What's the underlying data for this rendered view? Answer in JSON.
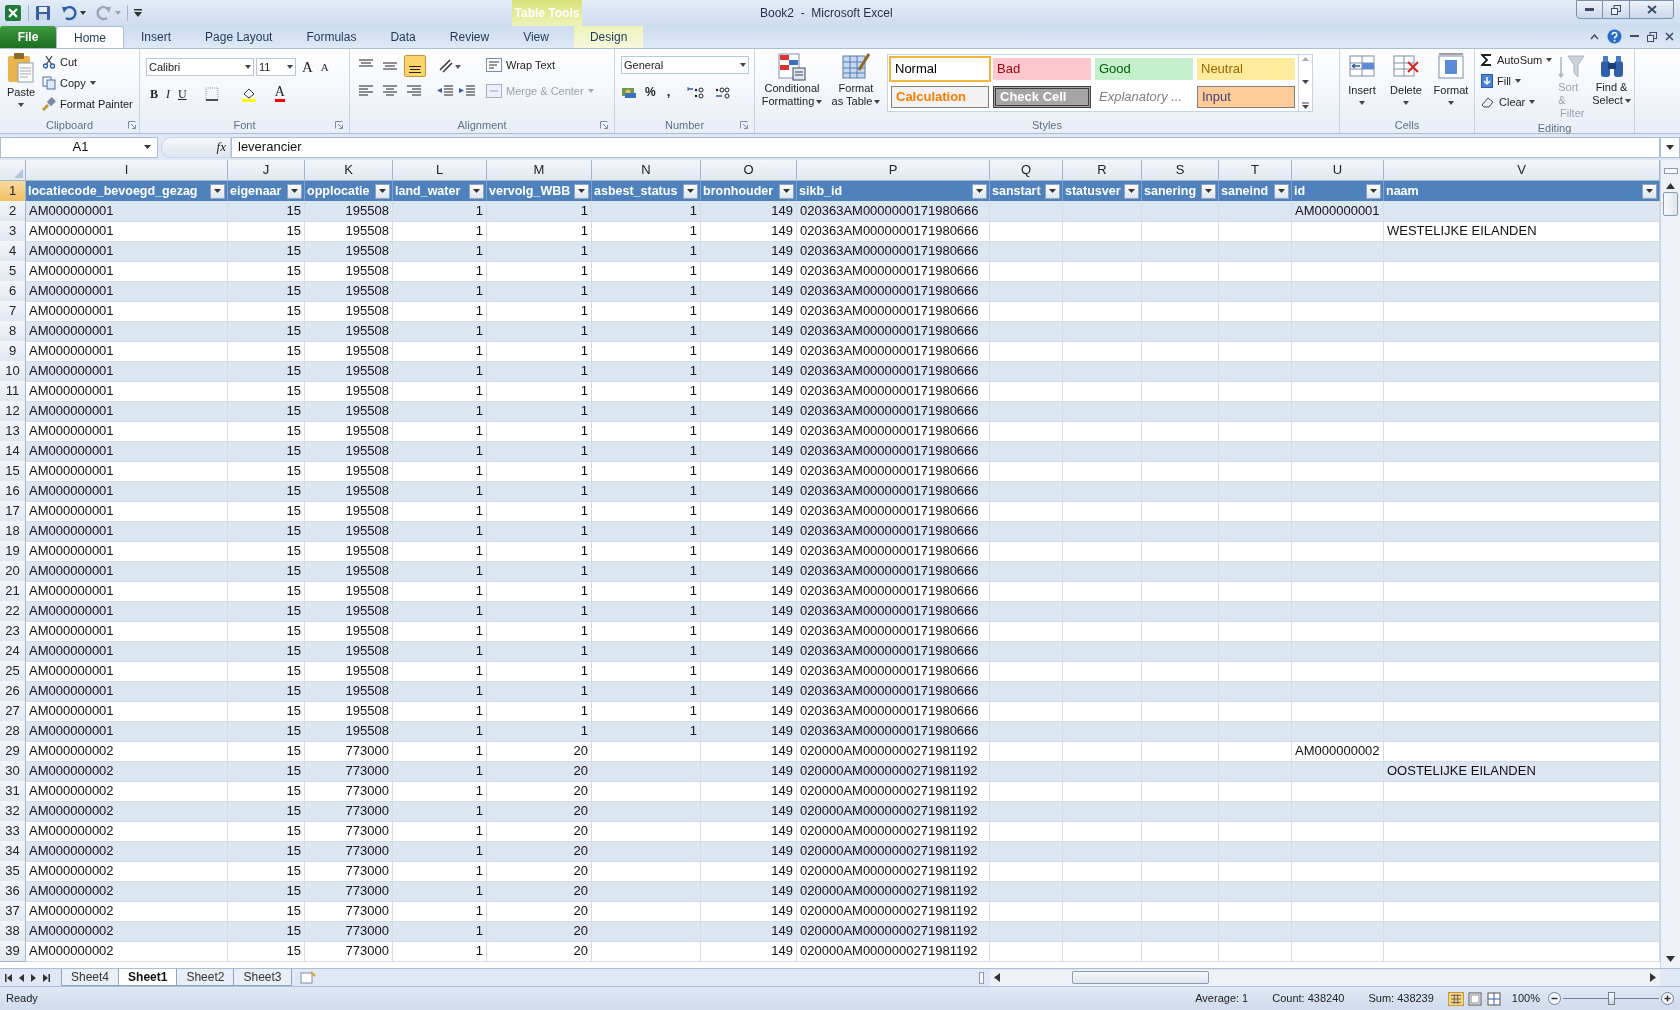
{
  "window": {
    "title": "Book2  -  Microsoft Excel",
    "context_tab_group": "Table Tools"
  },
  "tabs": [
    {
      "label": "File",
      "kind": "file",
      "selected": false
    },
    {
      "label": "Home",
      "kind": "normal",
      "selected": true
    },
    {
      "label": "Insert",
      "kind": "normal",
      "selected": false
    },
    {
      "label": "Page Layout",
      "kind": "normal",
      "selected": false
    },
    {
      "label": "Formulas",
      "kind": "normal",
      "selected": false
    },
    {
      "label": "Data",
      "kind": "normal",
      "selected": false
    },
    {
      "label": "Review",
      "kind": "normal",
      "selected": false
    },
    {
      "label": "View",
      "kind": "normal",
      "selected": false
    },
    {
      "label": "Design",
      "kind": "contextual",
      "selected": false
    }
  ],
  "ribbon": {
    "clipboard": {
      "label": "Clipboard",
      "paste": "Paste",
      "cut": "Cut",
      "copy": "Copy",
      "format_painter": "Format Painter"
    },
    "font": {
      "label": "Font",
      "font_name": "Calibri",
      "font_size": "11",
      "grow_font": "A",
      "shrink_font": "A",
      "bold": "B",
      "italic": "I",
      "underline": "U",
      "font_color": "A"
    },
    "alignment": {
      "label": "Alignment",
      "bottom_align_selected": true,
      "wrap_text": "Wrap Text",
      "merge_center": {
        "label": "Merge & Center",
        "disabled": true
      }
    },
    "number": {
      "label": "Number",
      "format": "General",
      "percent": "%",
      "comma": ","
    },
    "styles": {
      "label": "Styles",
      "conditional_formatting": [
        "Conditional",
        "Formatting"
      ],
      "format_as_table": [
        "Format",
        "as Table"
      ],
      "gallery": [
        {
          "label": "Normal",
          "kind": "normal",
          "selected": true
        },
        {
          "label": "Bad",
          "kind": "bad",
          "selected": false
        },
        {
          "label": "Good",
          "kind": "good",
          "selected": false
        },
        {
          "label": "Neutral",
          "kind": "neutral",
          "selected": false
        },
        {
          "label": "Calculation",
          "kind": "calculation",
          "selected": false
        },
        {
          "label": "Check Cell",
          "kind": "check",
          "selected": false
        },
        {
          "label": "Explanatory ...",
          "kind": "explanatory",
          "selected": false
        },
        {
          "label": "Input",
          "kind": "input",
          "selected": false
        }
      ]
    },
    "cells": {
      "label": "Cells",
      "insert": "Insert",
      "delete": "Delete",
      "format": "Format"
    },
    "editing": {
      "label": "Editing",
      "autosum": "AutoSum",
      "fill": "Fill",
      "clear": "Clear",
      "sort_filter": {
        "label": [
          "Sort &",
          "Filter"
        ],
        "disabled": true
      },
      "find_select": [
        "Find &",
        "Select"
      ]
    }
  },
  "formula_bar": {
    "name_box": "A1",
    "fx": "fx",
    "value": "leverancier"
  },
  "columns": [
    {
      "letter": "I",
      "header": "locatiecode_bevoegd_gezag",
      "kind": "text"
    },
    {
      "letter": "J",
      "header": "eigenaar",
      "kind": "number"
    },
    {
      "letter": "K",
      "header": "opplocatie",
      "kind": "number"
    },
    {
      "letter": "L",
      "header": "land_water",
      "kind": "number"
    },
    {
      "letter": "M",
      "header": "vervolg_WBB",
      "kind": "number"
    },
    {
      "letter": "N",
      "header": "asbest_status",
      "kind": "number"
    },
    {
      "letter": "O",
      "header": "bronhouder",
      "kind": "number"
    },
    {
      "letter": "P",
      "header": "sikb_id",
      "kind": "text"
    },
    {
      "letter": "Q",
      "header": "sanstart",
      "kind": "text"
    },
    {
      "letter": "R",
      "header": "statusver",
      "kind": "text"
    },
    {
      "letter": "S",
      "header": "sanering",
      "kind": "text"
    },
    {
      "letter": "T",
      "header": "saneind",
      "kind": "text"
    },
    {
      "letter": "U",
      "header": "id",
      "kind": "text"
    },
    {
      "letter": "V",
      "header": "naam",
      "kind": "text"
    }
  ],
  "header_row": {
    "number": "1",
    "selected": true
  },
  "rows": [
    {
      "number": "2",
      "selected": false,
      "cells": [
        "AM000000001",
        "15",
        "195508",
        "1",
        "1",
        "1",
        "149",
        "020363AM0000000171980666",
        null,
        null,
        null,
        null,
        "AM000000001",
        null
      ]
    },
    {
      "number": "3",
      "selected": false,
      "cells": [
        "AM000000001",
        "15",
        "195508",
        "1",
        "1",
        "1",
        "149",
        "020363AM0000000171980666",
        null,
        null,
        null,
        null,
        null,
        "WESTELIJKE EILANDEN"
      ]
    },
    {
      "number": "4",
      "selected": false,
      "cells": [
        "AM000000001",
        "15",
        "195508",
        "1",
        "1",
        "1",
        "149",
        "020363AM0000000171980666",
        null,
        null,
        null,
        null,
        null,
        null
      ]
    },
    {
      "number": "5",
      "selected": false,
      "cells": [
        "AM000000001",
        "15",
        "195508",
        "1",
        "1",
        "1",
        "149",
        "020363AM0000000171980666",
        null,
        null,
        null,
        null,
        null,
        null
      ]
    },
    {
      "number": "6",
      "selected": false,
      "cells": [
        "AM000000001",
        "15",
        "195508",
        "1",
        "1",
        "1",
        "149",
        "020363AM0000000171980666",
        null,
        null,
        null,
        null,
        null,
        null
      ]
    },
    {
      "number": "7",
      "selected": false,
      "cells": [
        "AM000000001",
        "15",
        "195508",
        "1",
        "1",
        "1",
        "149",
        "020363AM0000000171980666",
        null,
        null,
        null,
        null,
        null,
        null
      ]
    },
    {
      "number": "8",
      "selected": false,
      "cells": [
        "AM000000001",
        "15",
        "195508",
        "1",
        "1",
        "1",
        "149",
        "020363AM0000000171980666",
        null,
        null,
        null,
        null,
        null,
        null
      ]
    },
    {
      "number": "9",
      "selected": false,
      "cells": [
        "AM000000001",
        "15",
        "195508",
        "1",
        "1",
        "1",
        "149",
        "020363AM0000000171980666",
        null,
        null,
        null,
        null,
        null,
        null
      ]
    },
    {
      "number": "10",
      "selected": false,
      "cells": [
        "AM000000001",
        "15",
        "195508",
        "1",
        "1",
        "1",
        "149",
        "020363AM0000000171980666",
        null,
        null,
        null,
        null,
        null,
        null
      ]
    },
    {
      "number": "11",
      "selected": false,
      "cells": [
        "AM000000001",
        "15",
        "195508",
        "1",
        "1",
        "1",
        "149",
        "020363AM0000000171980666",
        null,
        null,
        null,
        null,
        null,
        null
      ]
    },
    {
      "number": "12",
      "selected": false,
      "cells": [
        "AM000000001",
        "15",
        "195508",
        "1",
        "1",
        "1",
        "149",
        "020363AM0000000171980666",
        null,
        null,
        null,
        null,
        null,
        null
      ]
    },
    {
      "number": "13",
      "selected": false,
      "cells": [
        "AM000000001",
        "15",
        "195508",
        "1",
        "1",
        "1",
        "149",
        "020363AM0000000171980666",
        null,
        null,
        null,
        null,
        null,
        null
      ]
    },
    {
      "number": "14",
      "selected": false,
      "cells": [
        "AM000000001",
        "15",
        "195508",
        "1",
        "1",
        "1",
        "149",
        "020363AM0000000171980666",
        null,
        null,
        null,
        null,
        null,
        null
      ]
    },
    {
      "number": "15",
      "selected": false,
      "cells": [
        "AM000000001",
        "15",
        "195508",
        "1",
        "1",
        "1",
        "149",
        "020363AM0000000171980666",
        null,
        null,
        null,
        null,
        null,
        null
      ]
    },
    {
      "number": "16",
      "selected": false,
      "cells": [
        "AM000000001",
        "15",
        "195508",
        "1",
        "1",
        "1",
        "149",
        "020363AM0000000171980666",
        null,
        null,
        null,
        null,
        null,
        null
      ]
    },
    {
      "number": "17",
      "selected": false,
      "cells": [
        "AM000000001",
        "15",
        "195508",
        "1",
        "1",
        "1",
        "149",
        "020363AM0000000171980666",
        null,
        null,
        null,
        null,
        null,
        null
      ]
    },
    {
      "number": "18",
      "selected": false,
      "cells": [
        "AM000000001",
        "15",
        "195508",
        "1",
        "1",
        "1",
        "149",
        "020363AM0000000171980666",
        null,
        null,
        null,
        null,
        null,
        null
      ]
    },
    {
      "number": "19",
      "selected": false,
      "cells": [
        "AM000000001",
        "15",
        "195508",
        "1",
        "1",
        "1",
        "149",
        "020363AM0000000171980666",
        null,
        null,
        null,
        null,
        null,
        null
      ]
    },
    {
      "number": "20",
      "selected": false,
      "cells": [
        "AM000000001",
        "15",
        "195508",
        "1",
        "1",
        "1",
        "149",
        "020363AM0000000171980666",
        null,
        null,
        null,
        null,
        null,
        null
      ]
    },
    {
      "number": "21",
      "selected": false,
      "cells": [
        "AM000000001",
        "15",
        "195508",
        "1",
        "1",
        "1",
        "149",
        "020363AM0000000171980666",
        null,
        null,
        null,
        null,
        null,
        null
      ]
    },
    {
      "number": "22",
      "selected": false,
      "cells": [
        "AM000000001",
        "15",
        "195508",
        "1",
        "1",
        "1",
        "149",
        "020363AM0000000171980666",
        null,
        null,
        null,
        null,
        null,
        null
      ]
    },
    {
      "number": "23",
      "selected": false,
      "cells": [
        "AM000000001",
        "15",
        "195508",
        "1",
        "1",
        "1",
        "149",
        "020363AM0000000171980666",
        null,
        null,
        null,
        null,
        null,
        null
      ]
    },
    {
      "number": "24",
      "selected": false,
      "cells": [
        "AM000000001",
        "15",
        "195508",
        "1",
        "1",
        "1",
        "149",
        "020363AM0000000171980666",
        null,
        null,
        null,
        null,
        null,
        null
      ]
    },
    {
      "number": "25",
      "selected": false,
      "cells": [
        "AM000000001",
        "15",
        "195508",
        "1",
        "1",
        "1",
        "149",
        "020363AM0000000171980666",
        null,
        null,
        null,
        null,
        null,
        null
      ]
    },
    {
      "number": "26",
      "selected": false,
      "cells": [
        "AM000000001",
        "15",
        "195508",
        "1",
        "1",
        "1",
        "149",
        "020363AM0000000171980666",
        null,
        null,
        null,
        null,
        null,
        null
      ]
    },
    {
      "number": "27",
      "selected": false,
      "cells": [
        "AM000000001",
        "15",
        "195508",
        "1",
        "1",
        "1",
        "149",
        "020363AM0000000171980666",
        null,
        null,
        null,
        null,
        null,
        null
      ]
    },
    {
      "number": "28",
      "selected": false,
      "cells": [
        "AM000000001",
        "15",
        "195508",
        "1",
        "1",
        "1",
        "149",
        "020363AM0000000171980666",
        null,
        null,
        null,
        null,
        null,
        null
      ]
    },
    {
      "number": "29",
      "selected": false,
      "cells": [
        "AM000000002",
        "15",
        "773000",
        "1",
        "20",
        null,
        "149",
        "020000AM0000000271981192",
        null,
        null,
        null,
        null,
        "AM000000002",
        null
      ]
    },
    {
      "number": "30",
      "selected": false,
      "cells": [
        "AM000000002",
        "15",
        "773000",
        "1",
        "20",
        null,
        "149",
        "020000AM0000000271981192",
        null,
        null,
        null,
        null,
        null,
        "OOSTELIJKE EILANDEN"
      ]
    },
    {
      "number": "31",
      "selected": false,
      "cells": [
        "AM000000002",
        "15",
        "773000",
        "1",
        "20",
        null,
        "149",
        "020000AM0000000271981192",
        null,
        null,
        null,
        null,
        null,
        null
      ]
    },
    {
      "number": "32",
      "selected": false,
      "cells": [
        "AM000000002",
        "15",
        "773000",
        "1",
        "20",
        null,
        "149",
        "020000AM0000000271981192",
        null,
        null,
        null,
        null,
        null,
        null
      ]
    },
    {
      "number": "33",
      "selected": false,
      "cells": [
        "AM000000002",
        "15",
        "773000",
        "1",
        "20",
        null,
        "149",
        "020000AM0000000271981192",
        null,
        null,
        null,
        null,
        null,
        null
      ]
    },
    {
      "number": "34",
      "selected": false,
      "cells": [
        "AM000000002",
        "15",
        "773000",
        "1",
        "20",
        null,
        "149",
        "020000AM0000000271981192",
        null,
        null,
        null,
        null,
        null,
        null
      ]
    },
    {
      "number": "35",
      "selected": false,
      "cells": [
        "AM000000002",
        "15",
        "773000",
        "1",
        "20",
        null,
        "149",
        "020000AM0000000271981192",
        null,
        null,
        null,
        null,
        null,
        null
      ]
    },
    {
      "number": "36",
      "selected": false,
      "cells": [
        "AM000000002",
        "15",
        "773000",
        "1",
        "20",
        null,
        "149",
        "020000AM0000000271981192",
        null,
        null,
        null,
        null,
        null,
        null
      ]
    },
    {
      "number": "37",
      "selected": false,
      "cells": [
        "AM000000002",
        "15",
        "773000",
        "1",
        "20",
        null,
        "149",
        "020000AM0000000271981192",
        null,
        null,
        null,
        null,
        null,
        null
      ]
    },
    {
      "number": "38",
      "selected": false,
      "cells": [
        "AM000000002",
        "15",
        "773000",
        "1",
        "20",
        null,
        "149",
        "020000AM0000000271981192",
        null,
        null,
        null,
        null,
        null,
        null
      ]
    },
    {
      "number": "39",
      "selected": false,
      "cells": [
        "AM000000002",
        "15",
        "773000",
        "1",
        "20",
        null,
        "149",
        "020000AM0000000271981192",
        null,
        null,
        null,
        null,
        null,
        null
      ]
    }
  ],
  "sheet_tabs": [
    {
      "label": "Sheet4",
      "selected": false
    },
    {
      "label": "Sheet1",
      "selected": true
    },
    {
      "label": "Sheet2",
      "selected": false
    },
    {
      "label": "Sheet3",
      "selected": false
    }
  ],
  "status_bar": {
    "mode": "Ready",
    "average": "Average: 1",
    "count": "Count: 438240",
    "sum": "Sum: 438239",
    "zoom": "100%",
    "zoom_slider": {
      "level": 0.5
    }
  }
}
